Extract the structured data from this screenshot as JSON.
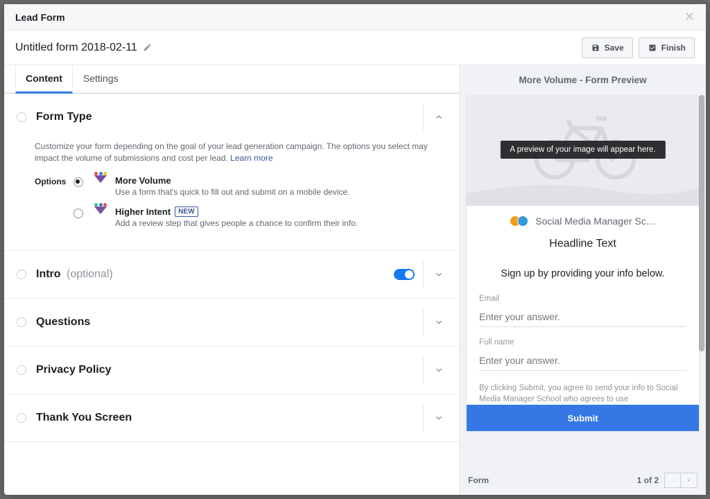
{
  "modal": {
    "title": "Lead Form"
  },
  "header": {
    "form_name": "Untitled form 2018-02-11",
    "save_label": "Save",
    "finish_label": "Finish"
  },
  "tabs": {
    "content": "Content",
    "settings": "Settings"
  },
  "sections": {
    "form_type": {
      "title": "Form Type",
      "desc": "Customize your form depending on the goal of your lead generation campaign. The options you select may impact the volume of submissions and cost per lead. ",
      "learn": "Learn more",
      "options_label": "Options",
      "options": [
        {
          "title": "More Volume",
          "desc": "Use a form that's quick to fill out and submit on a mobile device.",
          "checked": true
        },
        {
          "title": "Higher Intent",
          "badge": "NEW",
          "desc": "Add a review step that gives people a chance to confirm their info.",
          "checked": false
        }
      ]
    },
    "intro": {
      "title": "Intro",
      "optional": "(optional)",
      "toggle_on": true
    },
    "questions": {
      "title": "Questions"
    },
    "privacy": {
      "title": "Privacy Policy"
    },
    "thank_you": {
      "title": "Thank You Screen"
    }
  },
  "preview": {
    "title": "More Volume - Form Preview",
    "image_tooltip": "A preview of your image will appear here.",
    "page_name": "Social Media Manager Sc…",
    "headline": "Headline Text",
    "signup_text": "Sign up by providing your info below.",
    "fields": [
      {
        "label": "Email",
        "placeholder": "Enter your answer."
      },
      {
        "label": "Full name",
        "placeholder": "Enter your answer."
      }
    ],
    "consent": "By clicking Submit, you agree to send your info to Social Media Manager School who agrees to use",
    "submit": "Submit"
  },
  "pager": {
    "label": "Form",
    "info": "1 of 2"
  }
}
